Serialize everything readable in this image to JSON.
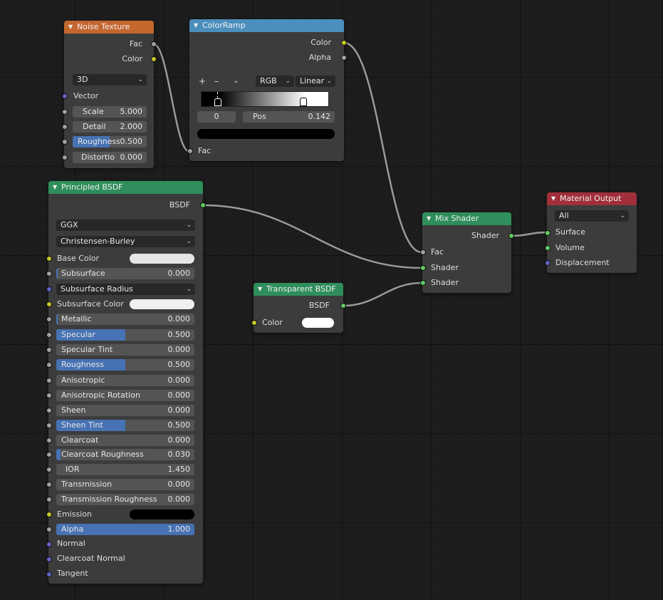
{
  "colors": {
    "header_texture": "#c4672f",
    "header_converter": "#4b8fbd",
    "header_shader": "#2f8e5b",
    "header_output": "#a12f3a",
    "node_body": "#3c3c3c",
    "accent_slider": "#4772b3",
    "socket_gray": "#a1a1a1",
    "socket_yellow": "#c7c729",
    "socket_green": "#62cb62",
    "socket_purple": "#6363c7"
  },
  "noise": {
    "title": "Noise Texture",
    "out_fac": "Fac",
    "out_color": "Color",
    "dimension": "3D",
    "vector": "Vector",
    "scale_label": "Scale",
    "scale_value": "5.000",
    "detail_label": "Detail",
    "detail_value": "2.000",
    "roughness_label": "Roughness",
    "roughness_value": "0.500",
    "distortion_label": "Distortio",
    "distortion_value": "0.000"
  },
  "colorramp": {
    "title": "ColorRamp",
    "out_color": "Color",
    "out_alpha": "Alpha",
    "add_icon": "+",
    "remove_icon": "–",
    "menu_icon": "chevron-down-icon",
    "color_mode": "RGB",
    "interpolation": "Linear",
    "stop_index": "0",
    "pos_label": "Pos",
    "pos_value": "0.142",
    "in_fac": "Fac"
  },
  "principled": {
    "title": "Principled BSDF",
    "out_bsdf": "BSDF",
    "distribution": "GGX",
    "subsurface_method": "Christensen-Burley",
    "base_color": "Base Color",
    "subsurface": "Subsurface",
    "subsurface_value": "0.000",
    "subsurface_radius": "Subsurface Radius",
    "subsurface_color": "Subsurface Color",
    "metallic": "Metallic",
    "metallic_value": "0.000",
    "specular": "Specular",
    "specular_value": "0.500",
    "specular_tint": "Specular Tint",
    "specular_tint_value": "0.000",
    "roughness": "Roughness",
    "roughness_value": "0.500",
    "anisotropic": "Anisotropic",
    "anisotropic_value": "0.000",
    "anisotropic_rotation": "Anisotropic Rotation",
    "anisotropic_rotation_value": "0.000",
    "sheen": "Sheen",
    "sheen_value": "0.000",
    "sheen_tint": "Sheen Tint",
    "sheen_tint_value": "0.500",
    "clearcoat": "Clearcoat",
    "clearcoat_value": "0.000",
    "clearcoat_roughness": "Clearcoat Roughness",
    "clearcoat_roughness_value": "0.030",
    "ior": "IOR",
    "ior_value": "1.450",
    "transmission": "Transmission",
    "transmission_value": "0.000",
    "transmission_roughness": "Transmission Roughness",
    "transmission_roughness_value": "0.000",
    "emission": "Emission",
    "alpha": "Alpha",
    "alpha_value": "1.000",
    "normal": "Normal",
    "clearcoat_normal": "Clearcoat Normal",
    "tangent": "Tangent"
  },
  "transparent": {
    "title": "Transparent BSDF",
    "out_bsdf": "BSDF",
    "color": "Color"
  },
  "mix": {
    "title": "Mix Shader",
    "out_shader": "Shader",
    "in_fac": "Fac",
    "in_shader1": "Shader",
    "in_shader2": "Shader"
  },
  "output": {
    "title": "Material Output",
    "target": "All",
    "surface": "Surface",
    "volume": "Volume",
    "displacement": "Displacement"
  }
}
